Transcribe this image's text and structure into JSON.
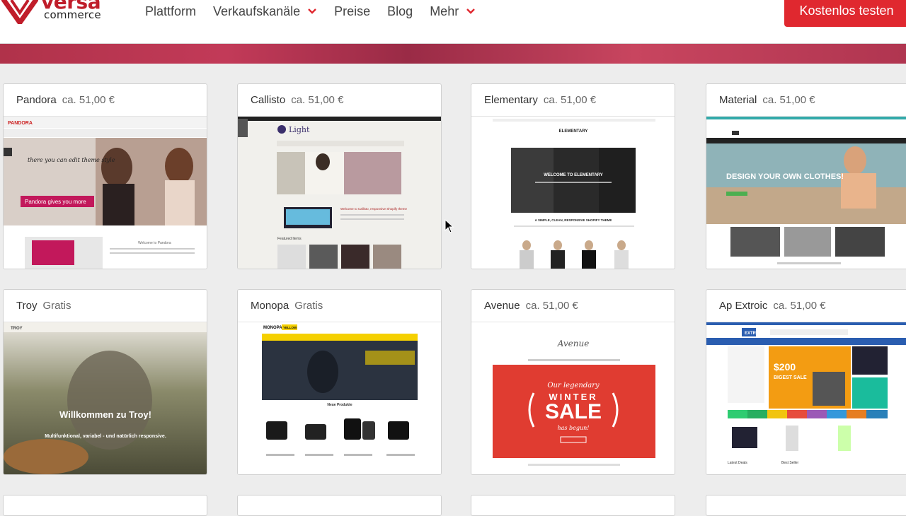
{
  "header": {
    "logo_text": "versa",
    "logo_sub": "commerce",
    "nav": [
      {
        "label": "Plattform",
        "has_dropdown": false
      },
      {
        "label": "Verkaufskanäle",
        "has_dropdown": true
      },
      {
        "label": "Preise",
        "has_dropdown": false
      },
      {
        "label": "Blog",
        "has_dropdown": false
      },
      {
        "label": "Mehr",
        "has_dropdown": true
      }
    ],
    "cta_label": "Kostenlos testen"
  },
  "themes": [
    {
      "name": "Pandora",
      "price": "ca. 51,00 €",
      "headline": "Pandora gives you more",
      "tagline": "there you can edit theme style",
      "welcome": "Welcome to Pandora"
    },
    {
      "name": "Callisto",
      "price": "ca. 51,00 €",
      "brand": "Light",
      "welcome": "Welcome to Callisto, responsive Shopify theme",
      "section": "Featured Items"
    },
    {
      "name": "Elementary",
      "price": "ca. 51,00 €",
      "brand": "ELEMENTARY",
      "welcome": "WELCOME TO ELEMENTARY",
      "subtitle": "A SIMPLE, CLEAN, RESPONSIVE SHOPIFY THEME"
    },
    {
      "name": "Material",
      "price": "ca. 51,00 €",
      "headline": "DESIGN YOUR OWN CLOTHES!"
    },
    {
      "name": "Troy",
      "price": "Gratis",
      "brand": "TROY",
      "headline": "Willkommen zu Troy!",
      "subtitle": "Multifunktional, variabel - und natürlich responsive."
    },
    {
      "name": "Monopa",
      "price": "Gratis",
      "brand": "MONOPA",
      "badge": "YELLOW",
      "section": "Neue Produkte"
    },
    {
      "name": "Avenue",
      "price": "ca. 51,00 €",
      "brand": "Avenue",
      "promo_top": "Our legendary",
      "promo_word1": "WINTER",
      "promo_word2": "SALE",
      "promo_bottom": "has begun!"
    },
    {
      "name": "Ap Extroic",
      "price": "ca. 51,00 €",
      "brand": "EXTROIC",
      "promo_price": "$200",
      "promo_label": "BIGEST SALE",
      "section_left": "Latest Deals",
      "section_right": "Best Seller"
    }
  ],
  "colors": {
    "brand_red": "#e0282f",
    "logo_red": "#c01d2a"
  }
}
